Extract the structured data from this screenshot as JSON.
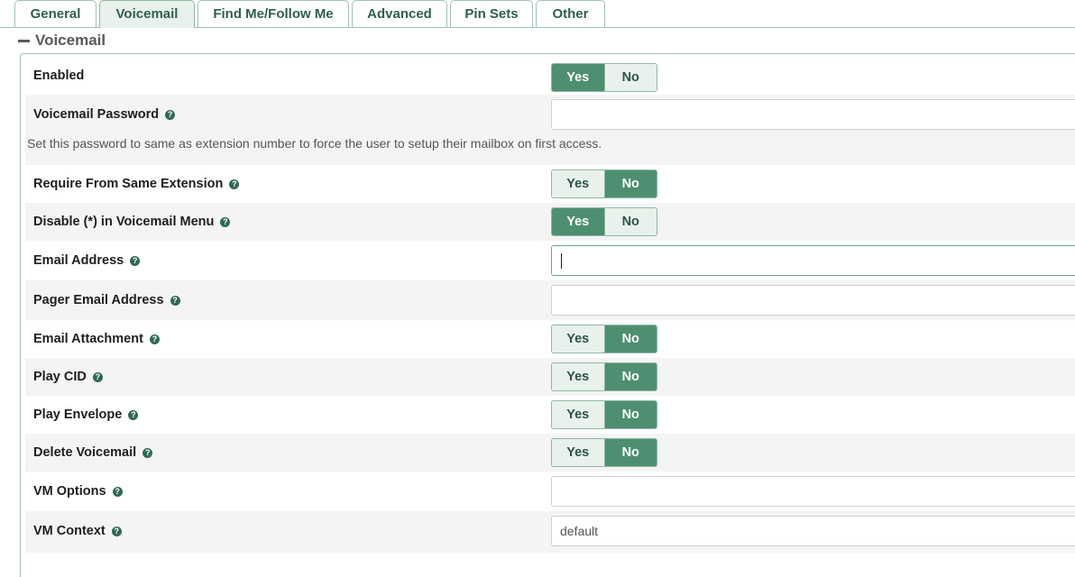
{
  "tabs": [
    {
      "label": "General",
      "active": false
    },
    {
      "label": "Voicemail",
      "active": true
    },
    {
      "label": "Find Me/Follow Me",
      "active": false
    },
    {
      "label": "Advanced",
      "active": false
    },
    {
      "label": "Pin Sets",
      "active": false
    },
    {
      "label": "Other",
      "active": false
    }
  ],
  "section": {
    "title": "Voicemail",
    "icon": "minus-icon"
  },
  "options": {
    "yes": "Yes",
    "no": "No"
  },
  "help_glyph": "?",
  "fields": {
    "enabled": {
      "label": "Enabled",
      "value": "Yes"
    },
    "vm_password": {
      "label": "Voicemail Password",
      "value": "",
      "help": "Set this password to same as extension number to force the user to setup their mailbox on first access."
    },
    "require_same_ext": {
      "label": "Require From Same Extension",
      "value": "No"
    },
    "disable_star": {
      "label": "Disable (*) in Voicemail Menu",
      "value": "Yes"
    },
    "email": {
      "label": "Email Address",
      "value": "",
      "focused": true
    },
    "pager_email": {
      "label": "Pager Email Address",
      "value": ""
    },
    "email_attachment": {
      "label": "Email Attachment",
      "value": "No"
    },
    "play_cid": {
      "label": "Play CID",
      "value": "No"
    },
    "play_envelope": {
      "label": "Play Envelope",
      "value": "No"
    },
    "delete_vm": {
      "label": "Delete Voicemail",
      "value": "No"
    },
    "vm_options": {
      "label": "VM Options",
      "value": ""
    },
    "vm_context": {
      "label": "VM Context",
      "value": "default"
    }
  },
  "colors": {
    "accent": "#4e8f6f",
    "accent_light": "#e8f1ec",
    "border": "#9fc4b1",
    "help_icon": "#2f6a55"
  }
}
